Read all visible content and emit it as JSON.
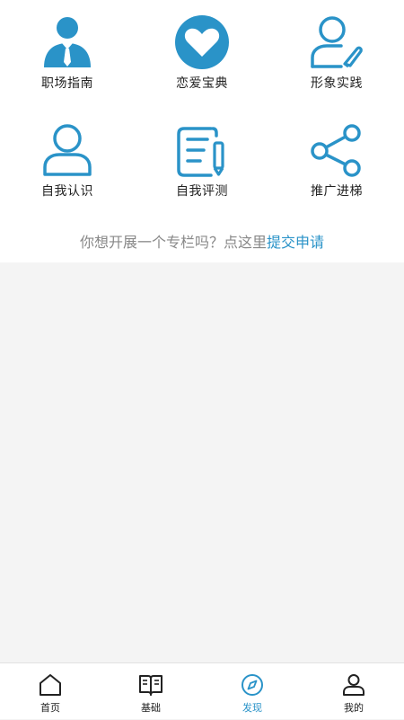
{
  "grid": [
    {
      "label": "职场指南",
      "icon": "businessman-icon"
    },
    {
      "label": "恋爱宝典",
      "icon": "heart-icon"
    },
    {
      "label": "形象实践",
      "icon": "person-pen-icon"
    },
    {
      "label": "自我认识",
      "icon": "user-icon"
    },
    {
      "label": "自我评测",
      "icon": "note-edit-icon"
    },
    {
      "label": "推广进梯",
      "icon": "share-icon"
    }
  ],
  "apply": {
    "prefix": "你想开展一个专栏吗？点这里",
    "link": "提交申请"
  },
  "tabs": [
    {
      "label": "首页",
      "icon": "home-icon",
      "active": false
    },
    {
      "label": "基础",
      "icon": "book-icon",
      "active": false
    },
    {
      "label": "发现",
      "icon": "compass-icon",
      "active": true
    },
    {
      "label": "我的",
      "icon": "profile-icon",
      "active": false
    }
  ],
  "colors": {
    "accent": "#2a93c8",
    "text": "#222222",
    "muted": "#888888",
    "background": "#f4f4f4"
  }
}
